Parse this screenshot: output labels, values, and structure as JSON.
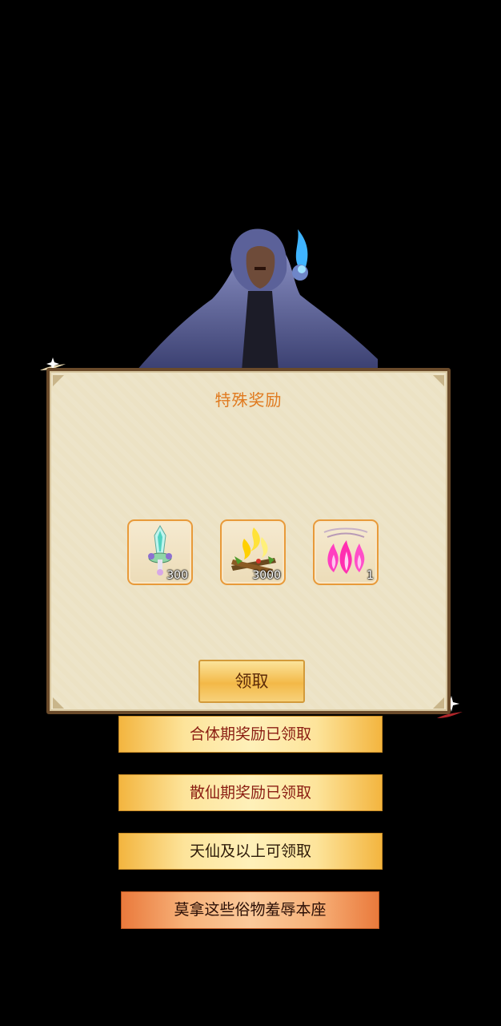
{
  "panel": {
    "title": "特殊奖励",
    "rewards": [
      {
        "icon": "jade-sword-icon",
        "count": "300"
      },
      {
        "icon": "golden-campfire-icon",
        "count": "3000"
      },
      {
        "icon": "pink-spirit-flame-icon",
        "count": "1"
      }
    ],
    "claim_label": "领取"
  },
  "options": [
    {
      "label": "合体期奖励已领取",
      "state": "claimed"
    },
    {
      "label": "散仙期奖励已领取",
      "state": "claimed"
    },
    {
      "label": "天仙及以上可领取",
      "state": "locked"
    },
    {
      "label": "莫拿这些俗物羞辱本座",
      "state": "dismiss"
    }
  ],
  "colors": {
    "title": "#e07a1f",
    "claimed_text": "#8a1d12",
    "button_gold": "#fde49b",
    "dismiss_orange": "#ea7a3c"
  }
}
